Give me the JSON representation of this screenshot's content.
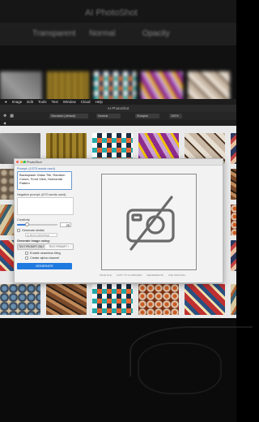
{
  "background": {
    "top_title": "AI PhotoShot",
    "top_bar_items": [
      "Transparent",
      "Normal",
      "Opacity"
    ]
  },
  "menubar": {
    "items": [
      "Image",
      "Edit",
      "Tools",
      "Text",
      "Window",
      "Cloud",
      "Help"
    ]
  },
  "window_title": "AI PhotoShot",
  "toolbar": {
    "fields": [
      "Standard (default)",
      "Normal",
      "Sharpen",
      "100%"
    ]
  },
  "dialog": {
    "title": "AI PhotoShot",
    "prompt_label": "Prompt: (1/270 words used)",
    "prompt_value": "Backsplash Glass Tile, Random Colors, Front View, Horizontal Pattern",
    "negative_label": "Negative prompt: (0/70 words used)",
    "creativity_label": "Creativity",
    "creativity_value": "25",
    "creativity_fraction": 0.25,
    "generate_similar_label": "Generate similar",
    "similar_placeholder": "by BK/LK DROPPED",
    "generate_using_label": "Generate image using:",
    "segments": [
      "TEXT PROMPT ONLY",
      "TEXT PROMPT + IMAGE"
    ],
    "seamless_label": "Enable seamless tiling",
    "alpha_label": "Create alpha channel",
    "generate_button": "GENERATE",
    "footer_items": [
      "SAVE FILE",
      "COPY TO CLIPBOARD",
      "REGENERATE",
      "USE ORIGINAL"
    ]
  }
}
